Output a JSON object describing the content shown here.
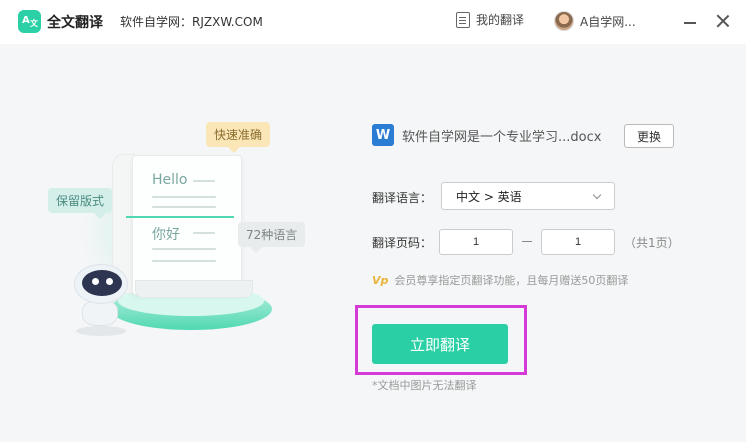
{
  "header": {
    "logo_text_a": "A",
    "logo_text_z": "文",
    "app_name": "全文翻译",
    "site_label": "软件自学网：RJZXW.COM",
    "my_translations": "我的翻译",
    "user_name": "A自学网..."
  },
  "illustration": {
    "badge_fast": "快速准确",
    "badge_keep": "保留版式",
    "badge_languages": "72种语言",
    "text_hello": "Hello",
    "text_nihao": "你好"
  },
  "file": {
    "icon_letter": "W",
    "name": "软件自学网是一个专业学习...docx",
    "change_label": "更换"
  },
  "language": {
    "label": "翻译语言：",
    "selected": "中文 > 英语"
  },
  "pages": {
    "label": "翻译页码：",
    "from": "1",
    "to": "1",
    "total": "（共1页）"
  },
  "vip": {
    "icon": "Vp",
    "text": "会员尊享指定页翻译功能，且每月赠送50页翻译"
  },
  "action": {
    "translate_label": "立即翻译",
    "note": "*文档中图片无法翻译"
  },
  "colors": {
    "accent": "#2bcfa5",
    "highlight": "#d63ad6",
    "word_blue": "#2b7cd3"
  }
}
